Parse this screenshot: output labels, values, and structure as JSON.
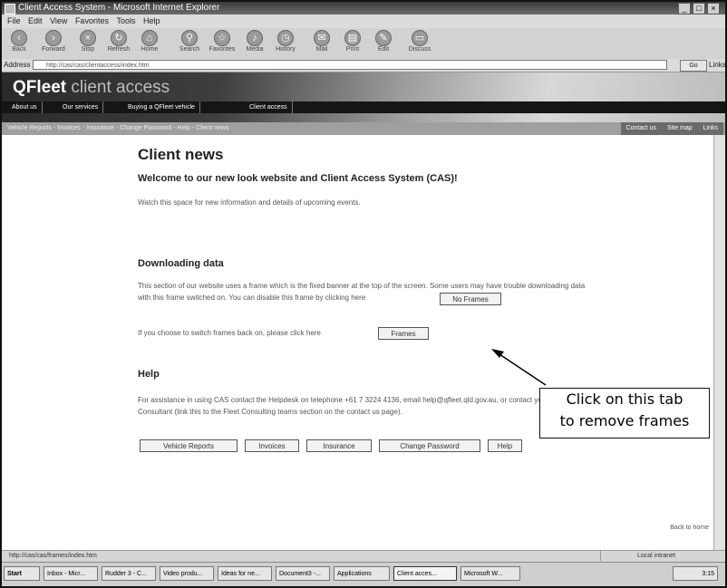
{
  "window": {
    "title": "Client Access System - Microsoft Internet Explorer",
    "buttons": [
      "_",
      "□",
      "×"
    ]
  },
  "menu": [
    "File",
    "Edit",
    "View",
    "Favorites",
    "Tools",
    "Help"
  ],
  "toolbar": [
    "Back",
    "Forward",
    "Stop",
    "Refresh",
    "Home",
    "Search",
    "Favorites",
    "Media",
    "History",
    "Mail",
    "Print",
    "Edit",
    "Discuss"
  ],
  "address": {
    "label": "Address",
    "url": "http://cas/cas/clientaccess/index.htm",
    "go": "Go",
    "links": "Links"
  },
  "banner": {
    "brand": "QFleet",
    "tagline": "client access"
  },
  "nav": [
    "About us",
    "Our services",
    "Buying a QFleet vehicle",
    "Client access"
  ],
  "subnav": {
    "crumbs": "Vehicle Reports - Invoices - Insurance - Change Password - Help - Client news",
    "right": [
      "Contact us",
      "Site map",
      "Links"
    ]
  },
  "page": {
    "title": "Client news",
    "welcome": "Welcome to our new look website and Client Access System (CAS)!",
    "watch": "Watch this space for new information and details of upcoming events.",
    "download_heading": "Downloading data",
    "download_text_1": "This section of our website uses a frame which is the fixed banner at the top of the screen. Some users may have trouble downloading data",
    "download_text_2": "with this frame switched on. You can disable this frame by clicking here",
    "no_frames_button": "No Frames",
    "frames_back_text": "If you choose to switch frames back on, please click here",
    "frames_button": "Frames",
    "help_heading": "Help",
    "help_text_1": "For assistance in using CAS contact the Helpdesk on telephone +61 7 3224 4136, email help@qfleet.qld.gov.au, or contact your Fleet",
    "help_text_2": "Consultant (link this to the Fleet Consulting teams section on the contact us page).",
    "buttons": [
      "Vehicle Reports",
      "Invoices",
      "Insurance",
      "Change Password",
      "Help"
    ],
    "back_to_top": "Back to home"
  },
  "callout": {
    "line1": "Click on this tab",
    "line2": "to remove frames"
  },
  "status": {
    "text": "http://cas/cas/frames/index.htm",
    "zone": "Local intranet"
  },
  "taskbar": [
    "Start",
    "Inbox - Micr...",
    "Rudder 3 - C...",
    "Video produ...",
    "Ideas for ne...",
    "Document3 -...",
    "Applications",
    "Client acces...",
    "Microsoft W..."
  ],
  "taskbar_clock": "3:15"
}
